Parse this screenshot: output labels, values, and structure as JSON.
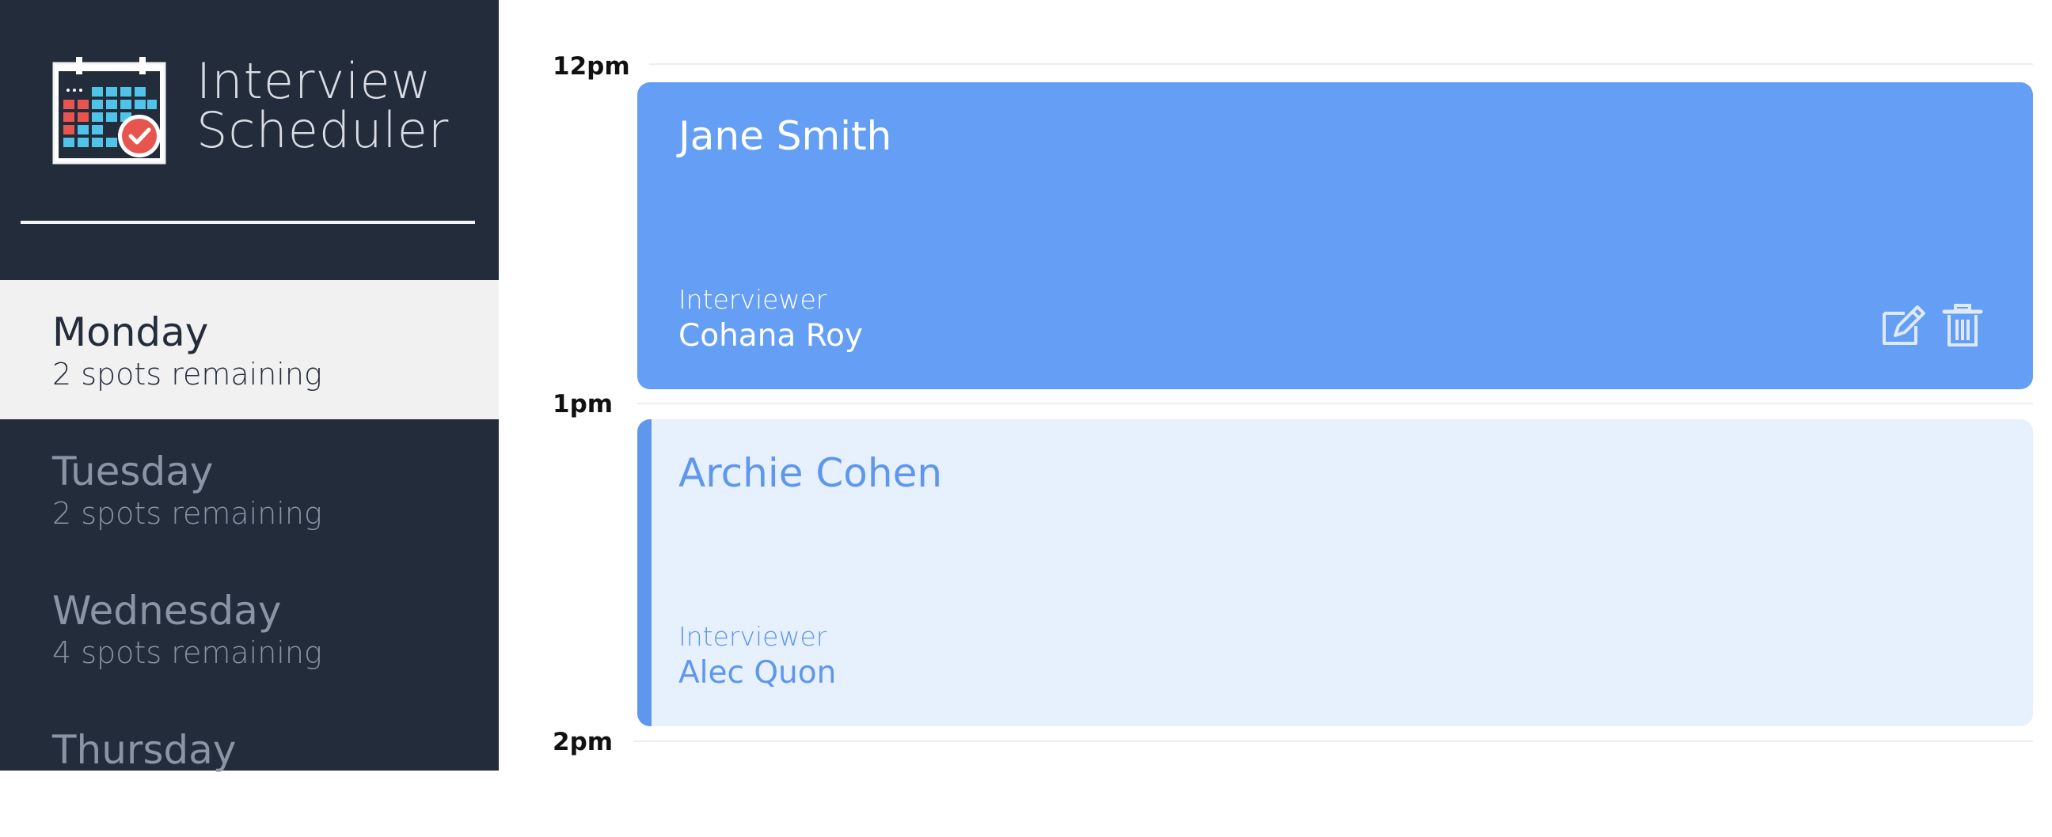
{
  "app": {
    "title_line1": "Interview",
    "title_line2": "Scheduler"
  },
  "sidebar": {
    "days": [
      {
        "name": "Monday",
        "spots": "2 spots remaining",
        "selected": true
      },
      {
        "name": "Tuesday",
        "spots": "2 spots remaining",
        "selected": false
      },
      {
        "name": "Wednesday",
        "spots": "4 spots remaining",
        "selected": false
      },
      {
        "name": "Thursday",
        "spots": "",
        "selected": false
      }
    ]
  },
  "schedule": {
    "times": [
      "12pm",
      "1pm",
      "2pm"
    ],
    "appointments": [
      {
        "student": "Jane Smith",
        "interviewer_label": "Interviewer",
        "interviewer": "Cohana Roy",
        "state": "booked",
        "actions": [
          "edit-icon",
          "trash-icon"
        ]
      },
      {
        "student": "Archie Cohen",
        "interviewer_label": "Interviewer",
        "interviewer": "Alec Quon",
        "state": "pending"
      }
    ]
  },
  "colors": {
    "sidebar": "#232c3b",
    "accent": "#659ef5",
    "pending_bg": "#e7f0fd",
    "selected_bg": "#f1f1f1"
  }
}
